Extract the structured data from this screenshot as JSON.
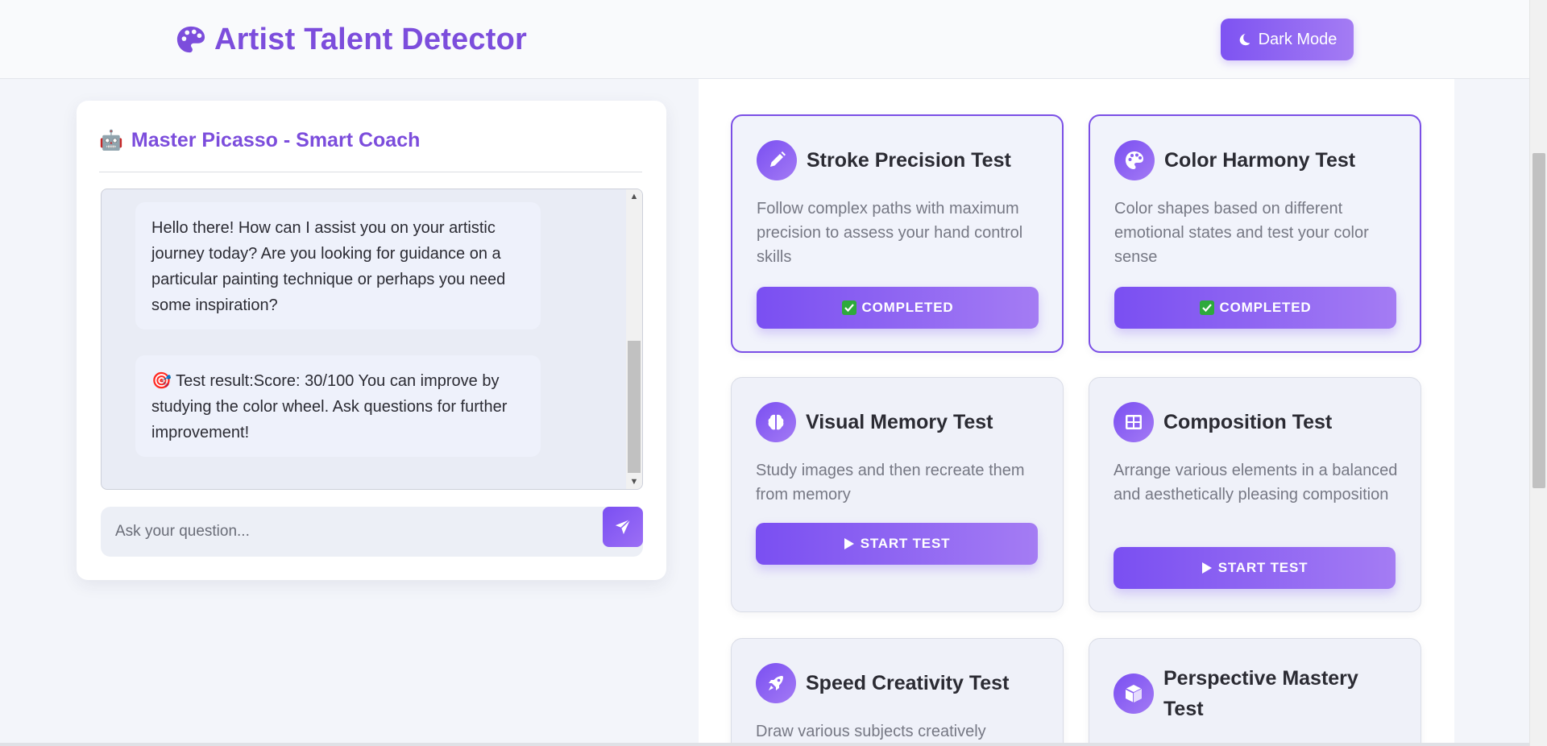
{
  "header": {
    "title": "Artist Talent Detector",
    "dark_mode_label": "Dark Mode"
  },
  "chat": {
    "title": "Master Picasso - Smart Coach",
    "messages": [
      {
        "text": "Hello there! How can I assist you on your artistic journey today? Are you looking for guidance on a particular painting technique or perhaps you need some inspiration?"
      },
      {
        "text": "🎯 Test result:Score: 30/100 You can improve by studying the color wheel. Ask questions for further improvement!"
      }
    ],
    "input_placeholder": "Ask your question..."
  },
  "tests": [
    {
      "title": "Stroke Precision Test",
      "description": "Follow complex paths with maximum precision to assess your hand control skills",
      "button": "COMPLETED",
      "status": "completed",
      "icon": "pencil-icon"
    },
    {
      "title": "Color Harmony Test",
      "description": "Color shapes based on different emotional states and test your color sense",
      "button": "COMPLETED",
      "status": "completed",
      "icon": "palette-icon"
    },
    {
      "title": "Visual Memory Test",
      "description": "Study images and then recreate them from memory",
      "button": "START TEST",
      "status": "pending",
      "icon": "brain-icon"
    },
    {
      "title": "Composition Test",
      "description": "Arrange various elements in a balanced and aesthetically pleasing composition",
      "button": "START TEST",
      "status": "pending",
      "icon": "grid-icon"
    },
    {
      "title": "Speed Creativity Test",
      "description": "Draw various subjects creatively",
      "button": "",
      "status": "pending",
      "icon": "rocket-icon"
    },
    {
      "title": "Perspective Mastery Test",
      "description": "",
      "button": "",
      "status": "pending",
      "icon": "cube-icon"
    }
  ],
  "colors": {
    "accent": "#7c4ddc",
    "button_gradient_start": "#7a4ff2",
    "button_gradient_end": "#a47cf3",
    "completed_check": "#2eaa3c"
  }
}
